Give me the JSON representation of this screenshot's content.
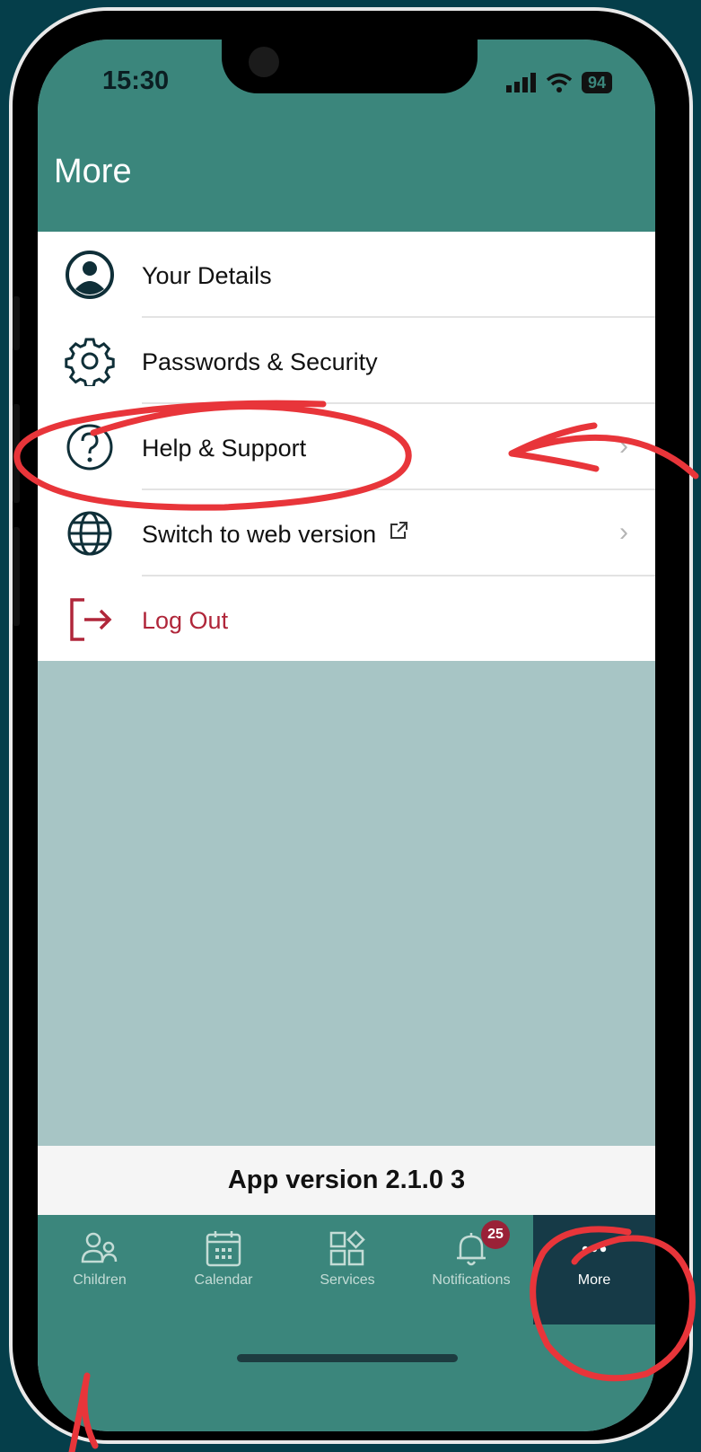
{
  "status_bar": {
    "time": "15:30",
    "battery": "94"
  },
  "header": {
    "title": "More"
  },
  "menu": {
    "items": [
      {
        "label": "Your Details",
        "icon": "user-circle-icon"
      },
      {
        "label": "Passwords & Security",
        "icon": "gear-icon"
      },
      {
        "label": "Help & Support",
        "icon": "question-circle-icon"
      },
      {
        "label": "Switch to web version",
        "icon": "globe-icon"
      },
      {
        "label": "Log Out",
        "icon": "logout-icon"
      }
    ]
  },
  "app_version": "App version 2.1.0 3",
  "tabbar": {
    "tabs": [
      {
        "label": "Children",
        "icon": "children-icon"
      },
      {
        "label": "Calendar",
        "icon": "calendar-icon"
      },
      {
        "label": "Services",
        "icon": "services-icon"
      },
      {
        "label": "Notifications",
        "icon": "bell-icon",
        "badge": "25"
      },
      {
        "label": "More",
        "icon": "more-dots-icon",
        "active": true
      }
    ]
  },
  "colors": {
    "brand_teal": "#3b867c",
    "active_tab": "#163a47",
    "logout_red": "#b0263a",
    "annotation_red": "#e8353a"
  }
}
